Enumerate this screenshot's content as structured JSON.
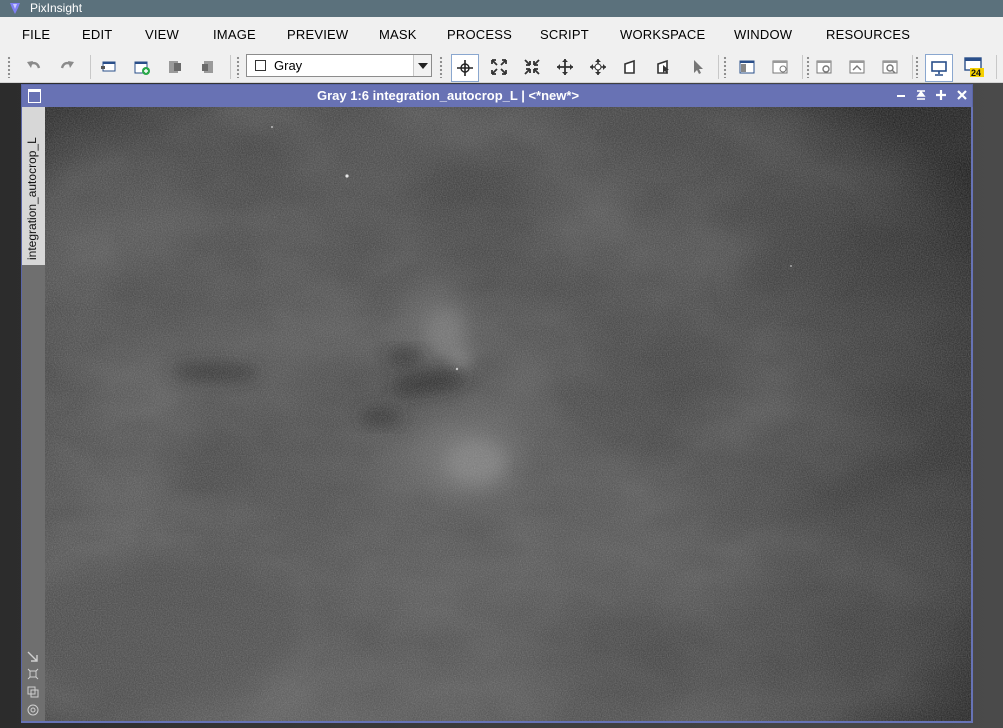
{
  "app": {
    "title": "PixInsight",
    "logo_icon": "pixinsight-logo-icon"
  },
  "menu": [
    "FILE",
    "EDIT",
    "VIEW",
    "IMAGE",
    "PREVIEW",
    "MASK",
    "PROCESS",
    "SCRIPT",
    "WORKSPACE",
    "WINDOW",
    "RESOURCES"
  ],
  "toolbar": {
    "channel_value": "Gray",
    "icons": [
      "undo-icon",
      "redo-icon",
      "new-window-icon",
      "new-preview-icon",
      "duplicate-icon",
      "extract-icon",
      "readout-mode-icon",
      "zoom-in-icon",
      "zoom-out-icon",
      "pan-icon",
      "center-icon",
      "mask-mode-icon",
      "edit-preview-icon",
      "pointer-icon",
      "show-mask-icon",
      "toggle-mask-icon",
      "stf-icon",
      "stf-link-icon",
      "stf-reset-icon",
      "display-icon",
      "24-bit-lut-icon"
    ],
    "lut_badge": "24"
  },
  "image_window": {
    "title": "Gray 1:6 integration_autocrop_L | <*new*>",
    "side_tab_label": "integration_autocrop_L",
    "side_icons": [
      "fit-view-icon",
      "zoom-fit-icon",
      "clone-view-icon",
      "target-icon"
    ]
  },
  "colors": {
    "window_frame": "#6773b6",
    "app_titlebar": "#5b717c",
    "menu_bg": "#f0f0f0"
  }
}
